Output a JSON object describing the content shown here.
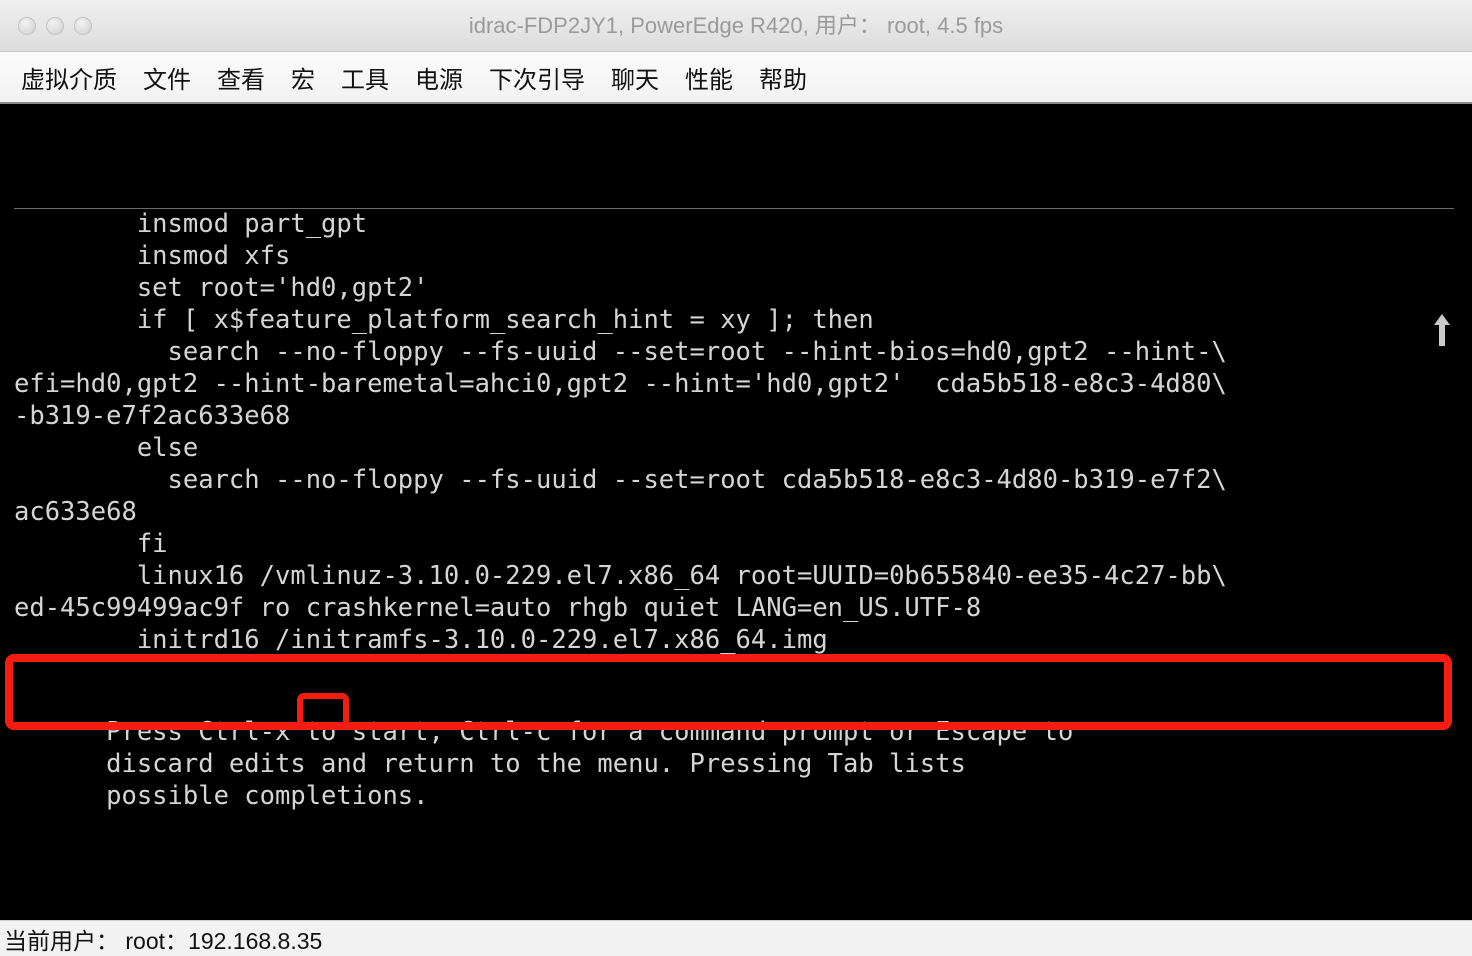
{
  "window": {
    "title": "idrac-FDP2JY1, PowerEdge R420, 用户： root, 4.5 fps",
    "controls": [
      "close",
      "minimize",
      "maximize"
    ]
  },
  "menubar": {
    "items": [
      {
        "label": "虚拟介质",
        "name": "menu-virtual-media"
      },
      {
        "label": "文件",
        "name": "menu-file"
      },
      {
        "label": "查看",
        "name": "menu-view"
      },
      {
        "label": "宏",
        "name": "menu-macro"
      },
      {
        "label": "工具",
        "name": "menu-tools"
      },
      {
        "label": "电源",
        "name": "menu-power"
      },
      {
        "label": "下次引导",
        "name": "menu-next-boot"
      },
      {
        "label": "聊天",
        "name": "menu-chat"
      },
      {
        "label": "性能",
        "name": "menu-performance"
      },
      {
        "label": "帮助",
        "name": "menu-help"
      }
    ]
  },
  "console": {
    "grub_text": "        insmod part_gpt\n        insmod xfs\n        set root='hd0,gpt2'\n        if [ x$feature_platform_search_hint = xy ]; then\n          search --no-floppy --fs-uuid --set=root --hint-bios=hd0,gpt2 --hint-\\\nefi=hd0,gpt2 --hint-baremetal=ahci0,gpt2 --hint='hd0,gpt2'  cda5b518-e8c3-4d80\\\n-b319-e7f2ac633e68\n        else\n          search --no-floppy --fs-uuid --set=root cda5b518-e8c3-4d80-b319-e7f2\\\nac633e68\n        fi\n        linux16 /vmlinuz-3.10.0-229.el7.x86_64 root=UUID=0b655840-ee35-4c27-bb\\\ned-45c99499ac9f ro crashkernel=auto rhgb quiet LANG=en_US.UTF-8\n        initrd16 /initramfs-3.10.0-229.el7.x86_64.img",
    "help_text": "      Press Ctrl-x to start, Ctrl-c for a command prompt or Escape to\n      discard edits and return to the menu. Pressing Tab lists\n      possible completions.",
    "scroll_up_indicator": "↑",
    "annotations": {
      "kernel_line_box": "linux16 kernel command line highlight",
      "ro_flag_box": "ro mount flag highlight",
      "color": "#f41d12"
    },
    "colors": {
      "background": "#000000",
      "foreground": "#d5d5d5"
    }
  },
  "statusbar": {
    "text": "当前用户： root：192.168.8.35"
  }
}
